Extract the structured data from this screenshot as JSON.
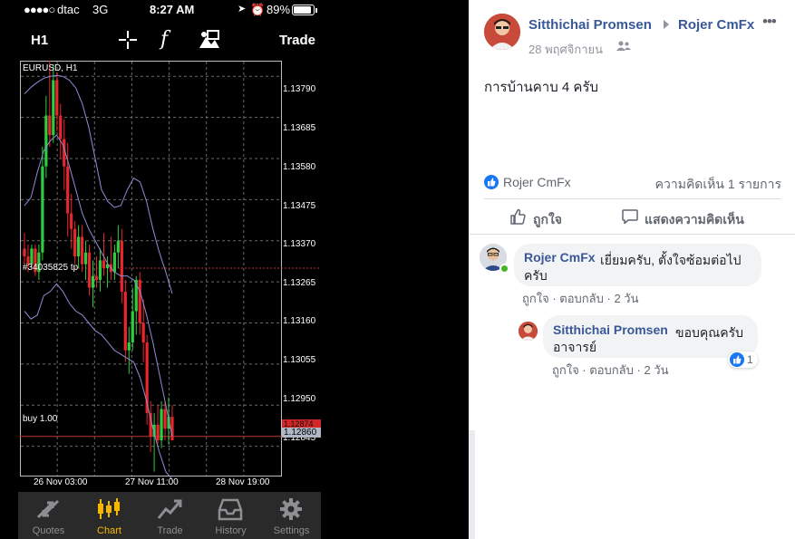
{
  "status_bar": {
    "signal": "●●●●○",
    "carrier": "dtac",
    "network": "3G",
    "time": "8:27 AM",
    "battery": "89%",
    "battery_level": 0.89
  },
  "toolbar": {
    "period": "H1",
    "trade_label": "Trade",
    "indicator_icon": "f"
  },
  "chart_data": {
    "type": "candlestick",
    "title": "EURUSD, H1",
    "y_ticks": [
      "1.13790",
      "1.13685",
      "1.13580",
      "1.13475",
      "1.13370",
      "1.13265",
      "1.13160",
      "1.13055",
      "1.12950",
      "1.12845"
    ],
    "x_ticks": [
      "26 Nov 03:00",
      "27 Nov 11:00",
      "28 Nov 19:00"
    ],
    "ylim": [
      1.1277,
      1.1383
    ],
    "order_label": "#34035825 tp",
    "order_level": 1.133,
    "buy_label": "buy 1.00",
    "buy_level": 1.1287,
    "price_sell_tag": "1.12874",
    "price_bid_tag": "1.12860",
    "grid": true,
    "candles": [
      [
        1.1335,
        1.1339,
        1.1331,
        1.1333
      ],
      [
        1.1333,
        1.1336,
        1.1329,
        1.1331
      ],
      [
        1.1331,
        1.1336,
        1.133,
        1.1335
      ],
      [
        1.1335,
        1.1336,
        1.1328,
        1.1329
      ],
      [
        1.1329,
        1.1336,
        1.1327,
        1.1334
      ],
      [
        1.1334,
        1.1361,
        1.1332,
        1.1356
      ],
      [
        1.1356,
        1.1374,
        1.1353,
        1.1369
      ],
      [
        1.1369,
        1.1383,
        1.1361,
        1.1364
      ],
      [
        1.1364,
        1.1382,
        1.1362,
        1.1378
      ],
      [
        1.1378,
        1.138,
        1.1365,
        1.1369
      ],
      [
        1.1369,
        1.1372,
        1.1358,
        1.1363
      ],
      [
        1.1363,
        1.1368,
        1.135,
        1.1356
      ],
      [
        1.1356,
        1.1362,
        1.1338,
        1.1344
      ],
      [
        1.1344,
        1.1349,
        1.1335,
        1.134
      ],
      [
        1.134,
        1.1342,
        1.1331,
        1.1333
      ],
      [
        1.1333,
        1.1341,
        1.133,
        1.1338
      ],
      [
        1.1338,
        1.1341,
        1.1329,
        1.1331
      ],
      [
        1.1331,
        1.1337,
        1.1327,
        1.1334
      ],
      [
        1.1334,
        1.1336,
        1.1323,
        1.1325
      ],
      [
        1.1325,
        1.1332,
        1.132,
        1.1328
      ],
      [
        1.1328,
        1.1333,
        1.1325,
        1.1327
      ],
      [
        1.1327,
        1.1335,
        1.1324,
        1.1332
      ],
      [
        1.1332,
        1.1339,
        1.1328,
        1.133
      ],
      [
        1.133,
        1.1333,
        1.1325,
        1.1331
      ],
      [
        1.1331,
        1.1338,
        1.1327,
        1.1329
      ],
      [
        1.1329,
        1.1336,
        1.1327,
        1.1334
      ],
      [
        1.1334,
        1.1341,
        1.133,
        1.1337
      ],
      [
        1.1337,
        1.134,
        1.1321,
        1.1324
      ],
      [
        1.1324,
        1.1327,
        1.1306,
        1.1309
      ],
      [
        1.1309,
        1.1315,
        1.1303,
        1.1311
      ],
      [
        1.1311,
        1.1325,
        1.1309,
        1.1319
      ],
      [
        1.1319,
        1.1328,
        1.1313,
        1.1327
      ],
      [
        1.1327,
        1.1329,
        1.1313,
        1.1316
      ],
      [
        1.1316,
        1.1322,
        1.1306,
        1.1311
      ],
      [
        1.1311,
        1.1313,
        1.129,
        1.1293
      ],
      [
        1.1293,
        1.1296,
        1.1283,
        1.1287
      ],
      [
        1.1287,
        1.1293,
        1.1278,
        1.129
      ],
      [
        1.129,
        1.1295,
        1.1285,
        1.1286
      ],
      [
        1.1286,
        1.1296,
        1.1284,
        1.1294
      ],
      [
        1.1294,
        1.1296,
        1.1286,
        1.1289
      ],
      [
        1.1289,
        1.1297,
        1.1285,
        1.1292
      ],
      [
        1.1292,
        1.1295,
        1.1286,
        1.1286
      ]
    ],
    "bollinger": {
      "upper": [
        1.13745,
        1.13762,
        1.13775,
        1.13785,
        1.1379,
        1.13792,
        1.1379,
        1.1378,
        1.1376,
        1.1372,
        1.1366,
        1.1358,
        1.135,
        1.1347,
        1.13455,
        1.1346,
        1.135,
        1.1353,
        1.1352,
        1.1347,
        1.134,
        1.1334,
        1.1329,
        1.13235
      ],
      "middle": [
        1.1346,
        1.1348,
        1.13545,
        1.136,
        1.13625,
        1.1364,
        1.13615,
        1.1356,
        1.135,
        1.1344,
        1.134,
        1.1337,
        1.1334,
        1.1331,
        1.1329,
        1.1328,
        1.1328,
        1.1327,
        1.1324,
        1.1318,
        1.1311,
        1.1303,
        1.1295,
        1.1287
      ],
      "lower": [
        1.1319,
        1.1317,
        1.1318,
        1.1323,
        1.1324,
        1.1326,
        1.1324,
        1.1321,
        1.1319,
        1.1318,
        1.1316,
        1.1314,
        1.1313,
        1.1311,
        1.1309,
        1.1308,
        1.1307,
        1.1306,
        1.1302,
        1.1296,
        1.1289,
        1.1283,
        1.1278,
        1.1276
      ]
    },
    "colors": {
      "bull": "#2ecc40",
      "bear": "#e8262b",
      "band": "#8c8fd6",
      "grid": "#6a6a6a",
      "order_line": "#b23a3a",
      "buy_line": "#c0392b"
    }
  },
  "tabbar": {
    "tabs": [
      {
        "label": "Quotes",
        "icon": "quotes-arrows-icon"
      },
      {
        "label": "Chart",
        "icon": "candlestick-icon",
        "active": true
      },
      {
        "label": "Trade",
        "icon": "trend-line-icon"
      },
      {
        "label": "History",
        "icon": "inbox-tray-icon"
      },
      {
        "label": "Settings",
        "icon": "gear-icon"
      }
    ],
    "active_color": "#f5b800",
    "inactive_color": "#8e8e93"
  },
  "post": {
    "author": "Sitthichai Promsen",
    "target": "Rojer CmFx",
    "date": "28 พฤศจิกายน",
    "text": "การบ้านคาบ 4 ครับ",
    "like_names": "Rojer CmFx",
    "comment_count": "ความคิดเห็น 1 รายการ",
    "like_button": "ถูกใจ",
    "comment_button": "แสดงความคิดเห็น"
  },
  "comments": [
    {
      "author": "Rojer CmFx",
      "text_line1": "เยี่ยมครับ, ตั้งใจซ้อมต่อไป",
      "text_line2": "ครับ",
      "like": "ถูกใจ",
      "reply": "ตอบกลับ",
      "time": "2 วัน"
    },
    {
      "author": "Sitthichai Promsen",
      "text_line1": "ขอบคุณครับ",
      "text_line2": "อาจารย์",
      "like": "ถูกใจ",
      "reply": "ตอบกลับ",
      "time": "2 วัน",
      "reaction_count": "1"
    }
  ],
  "colors": {
    "fb_link": "#385898",
    "fb_blue": "#1877f2",
    "online": "#42b72a"
  }
}
